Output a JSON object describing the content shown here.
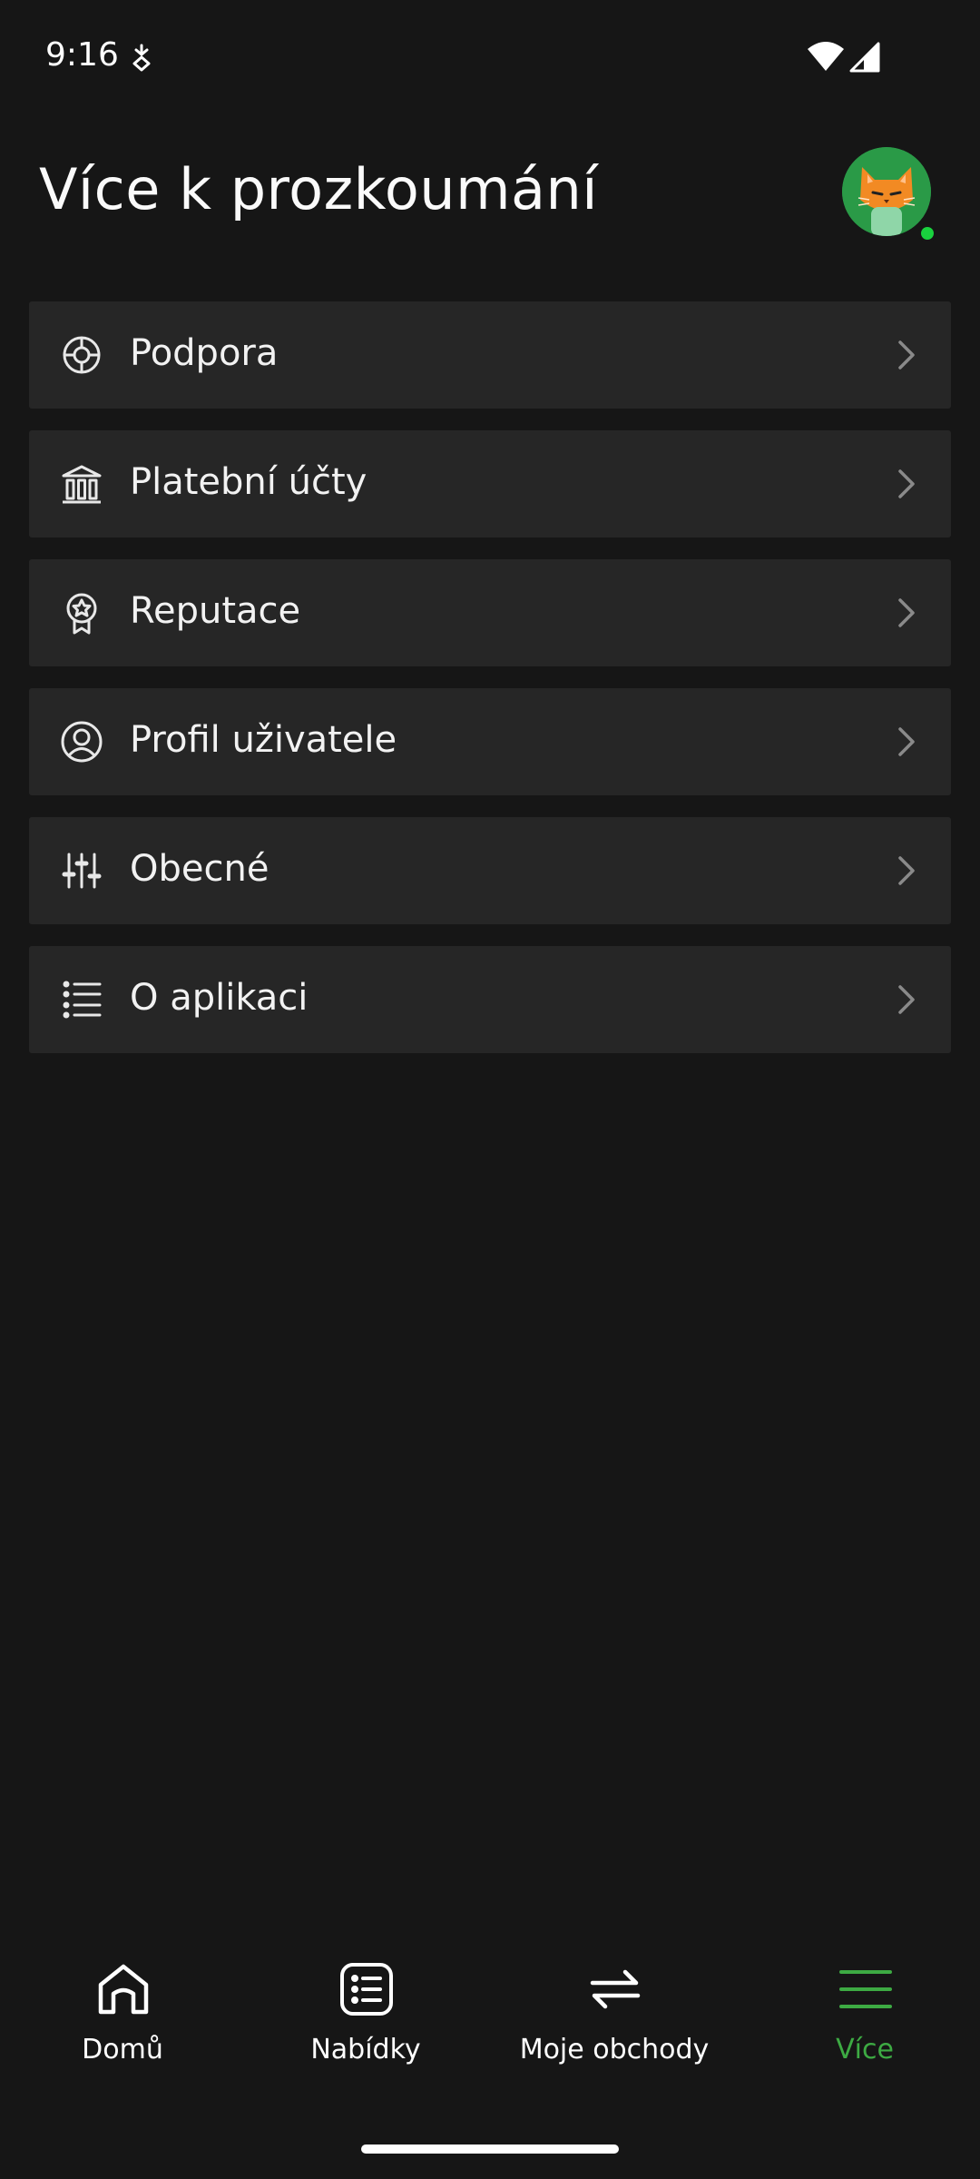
{
  "status_bar": {
    "time": "9:16"
  },
  "header": {
    "title": "Více k prozkoumání"
  },
  "menu": {
    "items": [
      {
        "label": "Podpora",
        "icon": "lifebuoy-icon"
      },
      {
        "label": "Platební účty",
        "icon": "bank-icon"
      },
      {
        "label": "Reputace",
        "icon": "award-badge-icon"
      },
      {
        "label": "Profil uživatele",
        "icon": "user-circle-icon"
      },
      {
        "label": "Obecné",
        "icon": "sliders-icon"
      },
      {
        "label": "O aplikaci",
        "icon": "list-icon"
      }
    ]
  },
  "bottom_nav": {
    "items": [
      {
        "label": "Domů",
        "icon": "home-icon",
        "active": false
      },
      {
        "label": "Nabídky",
        "icon": "offers-list-icon",
        "active": false
      },
      {
        "label": "Moje obchody",
        "icon": "swap-arrows-icon",
        "active": false
      },
      {
        "label": "Více",
        "icon": "menu-icon",
        "active": true
      }
    ]
  },
  "colors": {
    "background": "#161616",
    "card": "#262626",
    "accent": "#3daa43",
    "online": "#19d23e"
  }
}
